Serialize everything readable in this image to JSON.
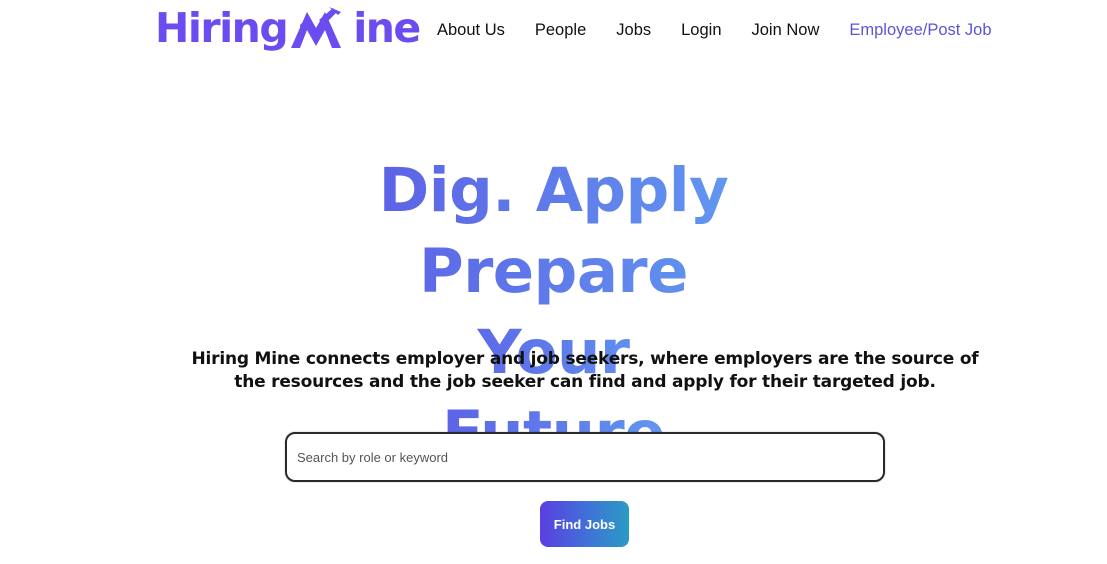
{
  "header": {
    "logo": {
      "text_left": "Hiring",
      "text_right": "ine",
      "mark_icon": "mountain-pickaxe-m-icon",
      "brand_color": "#6a4cf0"
    },
    "nav": [
      {
        "label": "About Us"
      },
      {
        "label": "People"
      },
      {
        "label": "Jobs"
      },
      {
        "label": "Login"
      },
      {
        "label": "Join Now"
      },
      {
        "label": "Employee/Post Job"
      }
    ],
    "accent_link_color": "#5b55d8"
  },
  "hero": {
    "title_line1": "Dig. Apply Prepare",
    "title_line2": "Your Future",
    "gradient_colors": [
      "#5b52e4",
      "#5f7bea",
      "#63aaf4"
    ],
    "subtitle": "Hiring Mine connects employer and job seekers, where employers are the source of the resources and the job seeker can find and apply for their targeted job."
  },
  "search": {
    "placeholder": "Search by role or keyword",
    "value": ""
  },
  "find_button": {
    "label": "Find Jobs",
    "gradient_colors": [
      "#5a3fe0",
      "#3f73d8",
      "#2a9cc4"
    ]
  }
}
